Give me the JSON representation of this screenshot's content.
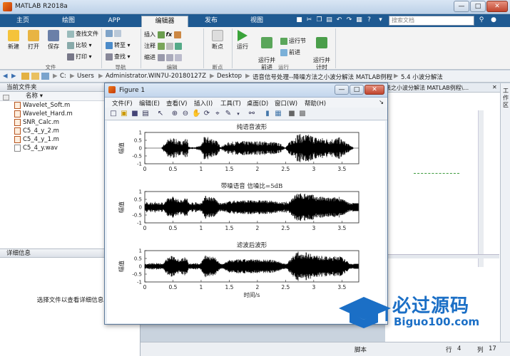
{
  "app": {
    "title": "MATLAB R2018a",
    "window_controls": [
      "—",
      "□",
      "✕"
    ]
  },
  "tabs": [
    {
      "label": "主页"
    },
    {
      "label": "绘图"
    },
    {
      "label": "APP"
    },
    {
      "label": "编辑器"
    },
    {
      "label": "发布"
    },
    {
      "label": "视图"
    }
  ],
  "search": {
    "placeholder": "搜索文档"
  },
  "ribbon": {
    "file": {
      "new": "新建",
      "open": "打开",
      "save": "保存",
      "find_files": "查找文件",
      "compare": "比较",
      "print": "打印",
      "group": "文件"
    },
    "nav": {
      "goto": "转至",
      "find": "查找",
      "group": "导航"
    },
    "edit": {
      "insert": "插入",
      "comment": "注释",
      "indent": "缩进",
      "group": "编辑"
    },
    "breakpoints": {
      "label": "断点",
      "group": "断点"
    },
    "run": {
      "run": "运行",
      "run_advance": "运行并\n前进",
      "run_section": "运行节",
      "advance": "前进",
      "run_time": "运行并\n计时",
      "group": "运行"
    }
  },
  "address": {
    "path": [
      "C:",
      "Users",
      "Administrator.WIN7U-20180127Z",
      "Desktop",
      "语音信号处理--降噪方法之小波分解法 MATLAB例程",
      "5.4 小波分解法"
    ]
  },
  "current_folder": {
    "title": "当前文件夹",
    "column": "名称",
    "files": [
      {
        "name": "Wavelet_Soft.m",
        "type": "m"
      },
      {
        "name": "Wavelet_Hard.m",
        "type": "m"
      },
      {
        "name": "SNR_Calc.m",
        "type": "m"
      },
      {
        "name": "C5_4_y_2.m",
        "type": "m"
      },
      {
        "name": "C5_4_y_1.m",
        "type": "m"
      },
      {
        "name": "C5_4_y.wav",
        "type": "wav"
      }
    ]
  },
  "details": {
    "title": "详细信息",
    "hint": "选择文件以查看详细信息"
  },
  "editor_tab_fragment": "法之小波分解法 MATLAB例程\\...",
  "workspace_label": "工作区",
  "status": {
    "mode": "脚本",
    "row_label": "行",
    "row": "4",
    "col_label": "列",
    "col": "17"
  },
  "figure": {
    "title": "Figure 1",
    "menu": [
      "文件(F)",
      "编辑(E)",
      "查看(V)",
      "插入(I)",
      "工具(T)",
      "桌面(D)",
      "窗口(W)",
      "帮助(H)"
    ]
  },
  "chart_data": [
    {
      "type": "line",
      "title": "纯语音波形",
      "ylabel": "幅值",
      "xlabel": "",
      "xlim": [
        0,
        3.8
      ],
      "ylim": [
        -1,
        1
      ],
      "xticks": [
        "0",
        "0.5",
        "1",
        "1.5",
        "2",
        "2.5",
        "3",
        "3.5"
      ],
      "yticks": [
        "1",
        "0.5",
        "0",
        "-0.5",
        "-1"
      ],
      "envelope": {
        "x": [
          0.3,
          0.4,
          0.5,
          0.62,
          0.75,
          0.78,
          0.9,
          1.0,
          1.05,
          1.1,
          1.25,
          1.35,
          1.5,
          1.7,
          1.85,
          2.1,
          2.3,
          2.4,
          2.5,
          2.62,
          2.72,
          2.8,
          2.85,
          2.95,
          3.05,
          3.2,
          3.3,
          3.45,
          3.55,
          3.7
        ],
        "y": [
          0.05,
          0.55,
          0.7,
          0.45,
          0.65,
          0.08,
          0.05,
          0.2,
          0.7,
          0.75,
          0.6,
          0.1,
          0.4,
          0.45,
          0.45,
          0.45,
          0.4,
          0.3,
          0.05,
          0.65,
          0.95,
          0.85,
          0.9,
          0.85,
          0.7,
          0.65,
          0.6,
          0.7,
          0.45,
          0.05
        ]
      }
    },
    {
      "type": "line",
      "title": "带噪语音 信噪比=5dB",
      "ylabel": "幅值",
      "xlabel": "",
      "xlim": [
        0,
        3.8
      ],
      "ylim": [
        -1,
        1
      ],
      "xticks": [
        "0",
        "0.5",
        "1",
        "1.5",
        "2",
        "2.5",
        "3",
        "3.5"
      ],
      "yticks": [
        "1",
        "0.5",
        "0",
        "-0.5",
        "-1"
      ],
      "noise_floor": 0.35
    },
    {
      "type": "line",
      "title": "滤波后波形",
      "ylabel": "幅值",
      "xlabel": "时间/s",
      "xlim": [
        0,
        3.8
      ],
      "ylim": [
        -1,
        1
      ],
      "xticks": [
        "0",
        "0.5",
        "1",
        "1.5",
        "2",
        "2.5",
        "3",
        "3.5"
      ],
      "yticks": [
        "1",
        "0.5",
        "0",
        "-0.5",
        "-1"
      ],
      "noise_floor": 0.22
    }
  ],
  "watermark": {
    "cn": "必过源码",
    "en": "Biguo100.com"
  },
  "colors": {
    "accent": "#1f5a92",
    "ribbon": "#f3f3f3",
    "plot_line": "#000000"
  }
}
